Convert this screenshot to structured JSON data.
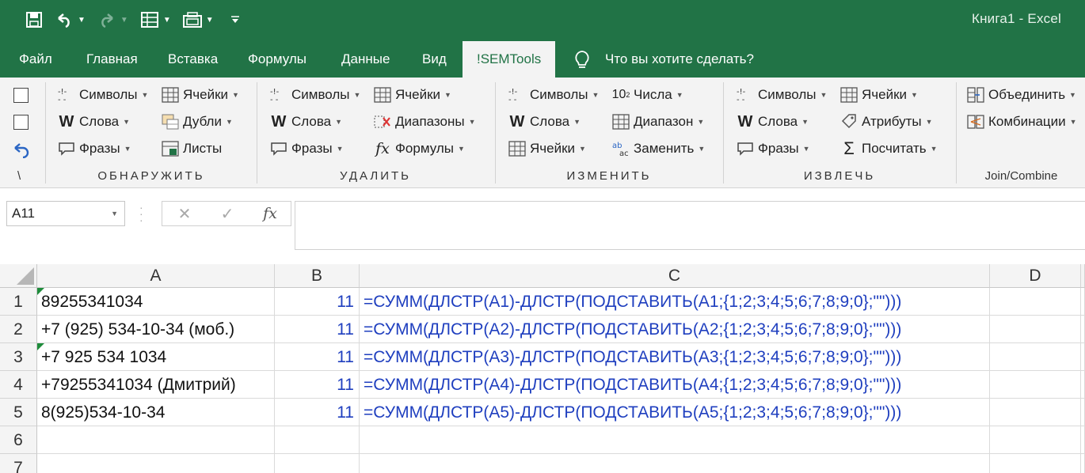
{
  "window": {
    "title": "Книга1  -  Excel"
  },
  "qat": [
    "save-icon",
    "undo-icon",
    "redo-icon",
    "form-icon",
    "camera-icon",
    "customize-icon"
  ],
  "tabs": [
    "Файл",
    "Главная",
    "Вставка",
    "Формулы",
    "Данные",
    "Вид",
    "!SEMTools"
  ],
  "tell_me": "Что вы хотите сделать?",
  "ribbon": {
    "left": {
      "backslash": "\\"
    },
    "detect": {
      "label": "ОБНАРУЖИТЬ",
      "items": [
        "Символы",
        "Слова",
        "Фразы",
        "Ячейки",
        "Дубли",
        "Листы"
      ]
    },
    "delete": {
      "label": "УДАЛИТЬ",
      "items": [
        "Символы",
        "Слова",
        "Фразы",
        "Ячейки",
        "Диапазоны",
        "Формулы"
      ]
    },
    "change": {
      "label": "ИЗМЕНИТЬ",
      "items": [
        "Символы",
        "Слова",
        "Ячейки",
        "Числа",
        "Диапазон",
        "Заменить"
      ]
    },
    "extract": {
      "label": "ИЗВЛЕЧЬ",
      "items": [
        "Символы",
        "Слова",
        "Фразы",
        "Ячейки",
        "Атрибуты",
        "Посчитать"
      ]
    },
    "join": {
      "label": "Join/Combine",
      "items": [
        "Объединить",
        "Комбинации"
      ]
    }
  },
  "formula_bar": {
    "name_box": "A11",
    "cancel": "✕",
    "enter": "✓",
    "fx": "fx",
    "content": ""
  },
  "sheet": {
    "columns": [
      "A",
      "B",
      "C",
      "D"
    ],
    "rows": [
      {
        "n": "1",
        "a": "89255341034",
        "b": "11",
        "c": "=СУММ(ДЛСТР(A1)-ДЛСТР(ПОДСТАВИТЬ(A1;{1;2;3;4;5;6;7;8;9;0};\"\")))",
        "a_flag": true
      },
      {
        "n": "2",
        "a": "+7 (925) 534-10-34 (моб.)",
        "b": "11",
        "c": "=СУММ(ДЛСТР(A2)-ДЛСТР(ПОДСТАВИТЬ(A2;{1;2;3;4;5;6;7;8;9;0};\"\")))",
        "a_flag": false
      },
      {
        "n": "3",
        "a": "+7 925 534 1034",
        "b": "11",
        "c": "=СУММ(ДЛСТР(A3)-ДЛСТР(ПОДСТАВИТЬ(A3;{1;2;3;4;5;6;7;8;9;0};\"\")))",
        "a_flag": true
      },
      {
        "n": "4",
        "a": "+79255341034 (Дмитрий)",
        "b": "11",
        "c": "=СУММ(ДЛСТР(A4)-ДЛСТР(ПОДСТАВИТЬ(A4;{1;2;3;4;5;6;7;8;9;0};\"\")))",
        "a_flag": false
      },
      {
        "n": "5",
        "a": "8(925)534-10-34",
        "b": "11",
        "c": "=СУММ(ДЛСТР(A5)-ДЛСТР(ПОДСТАВИТЬ(A5;{1;2;3;4;5;6;7;8;9;0};\"\")))",
        "a_flag": false
      },
      {
        "n": "6",
        "a": "",
        "b": "",
        "c": "",
        "a_flag": false
      },
      {
        "n": "7",
        "a": "",
        "b": "",
        "c": "",
        "a_flag": false
      }
    ]
  },
  "colors": {
    "brand": "#217346",
    "formula_text": "#1f3fbf",
    "error_flag": "#1e8c3b"
  }
}
